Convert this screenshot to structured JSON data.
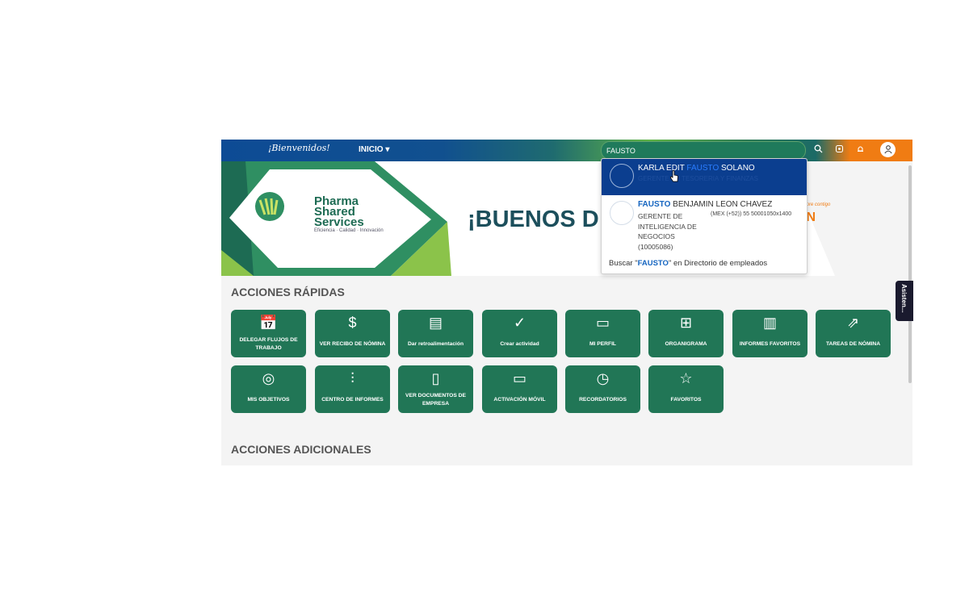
{
  "topbar": {
    "welcome": "¡Bienvenidos!",
    "inicio_label": "INICIO ▾",
    "search_value": "FAUSTO",
    "icons": [
      "search-icon",
      "help-icon",
      "notifications-icon",
      "user-avatar-icon"
    ]
  },
  "banner": {
    "logo_line1": "Pharma",
    "logo_line2": "Shared",
    "logo_line3": "Services",
    "logo_tagline": "Eficiencia · Calidad · Innovación",
    "greeting": "¡BUENOS D",
    "orange_text": "ÓN",
    "orange_small": "siempre contigo"
  },
  "search_results": [
    {
      "name_before": "KARLA EDIT ",
      "name_match": "FAUSTO",
      "name_after": " SOLANO",
      "detail": "GERENTE DE TESORERIA Y FINANZAS"
    },
    {
      "name_before": "",
      "name_match": "FAUSTO",
      "name_after": " BENJAMIN LEON CHAVEZ",
      "job_lines": [
        "GERENTE DE",
        "INTELIGENCIA DE",
        "NEGOCIOS",
        "(10005086)"
      ],
      "phone": "(MEX (+52)) 55 50001050x1400"
    }
  ],
  "directory_search": {
    "prefix": "Buscar \"",
    "query": "FAUSTO",
    "suffix": "\" en Directorio de empleados"
  },
  "quick_actions": {
    "title": "ACCIONES RÁPIDAS",
    "tiles": [
      {
        "label": "DELEGAR FLUJOS DE TRABAJO",
        "icon": "delegate-calendar-icon"
      },
      {
        "label": "VER RECIBO DE NÓMINA",
        "icon": "payslip-icon"
      },
      {
        "label": "Dar retroalimentación",
        "icon": "feedback-icon"
      },
      {
        "label": "Crear actividad",
        "icon": "clipboard-check-icon"
      },
      {
        "label": "MI PERFIL",
        "icon": "id-card-icon"
      },
      {
        "label": "ORGANIGRAMA",
        "icon": "org-chart-icon"
      },
      {
        "label": "INFORMES FAVORITOS",
        "icon": "reports-icon"
      },
      {
        "label": "TAREAS DE NÓMINA",
        "icon": "payroll-tasks-icon"
      },
      {
        "label": "MIS OBJETIVOS",
        "icon": "target-icon"
      },
      {
        "label": "CENTRO DE INFORMES",
        "icon": "chart-icon"
      },
      {
        "label": "VER DOCUMENTOS DE EMPRESA",
        "icon": "document-icon"
      },
      {
        "label": "ACTIVACIÓN MÓVIL",
        "icon": "mobile-device-icon"
      },
      {
        "label": "RECORDATORIOS",
        "icon": "reminder-icon"
      },
      {
        "label": "FAVORITOS",
        "icon": "favorites-star-icon"
      }
    ]
  },
  "additional_actions": {
    "title": "ACCIONES ADICIONALES"
  },
  "assistant": {
    "label": "Asisten..."
  }
}
